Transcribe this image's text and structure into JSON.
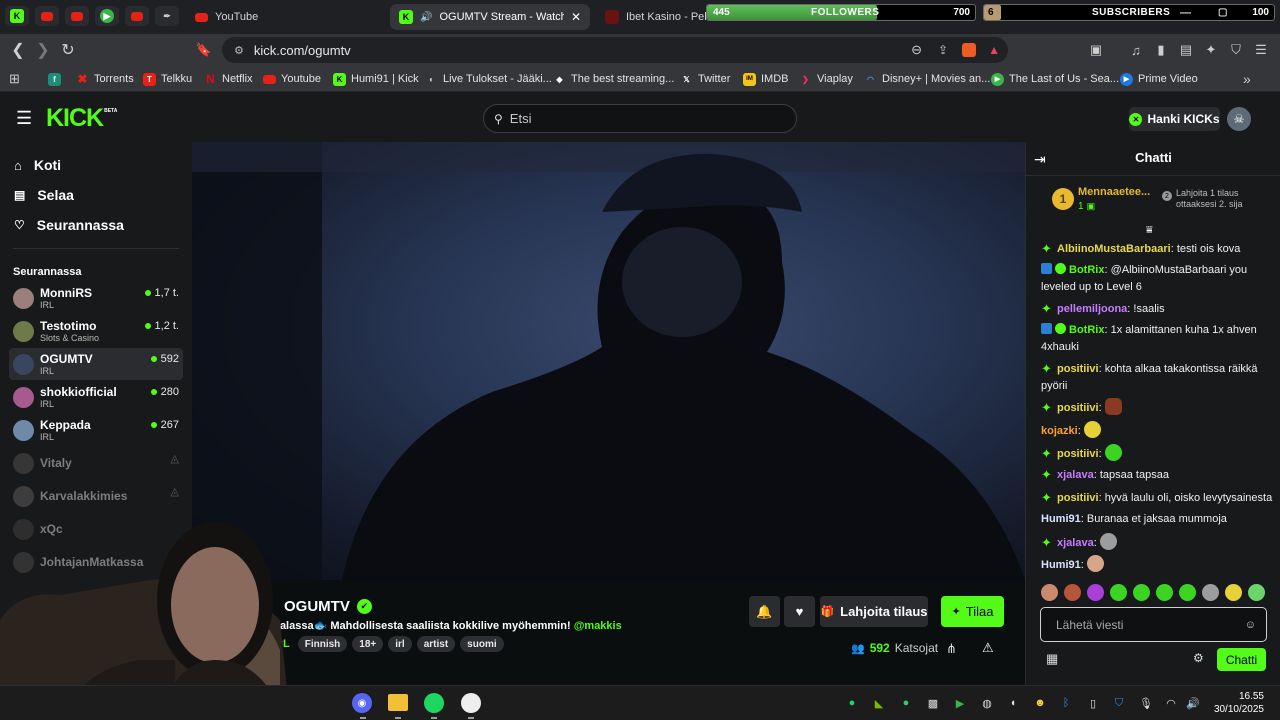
{
  "browser": {
    "tabs": [
      {
        "title": "YouTube",
        "favicon": "youtube-icon"
      },
      {
        "title": "OGUMTV Stream - Watch Live",
        "favicon": "kick-icon",
        "active": true,
        "audio": true
      },
      {
        "title": "Ibet Kasino - Pelaa",
        "favicon": "ibet-icon"
      }
    ],
    "url": "kick.com/ogumtv",
    "overlay": {
      "followers": {
        "current": "445",
        "label": "FOLLOWERS",
        "goal": "700",
        "progress": 0.636
      },
      "subscribers": {
        "current": "6",
        "label": "SUBSCRIBERS",
        "goal": "100",
        "progress": 0.06
      }
    },
    "bookmarks": [
      {
        "label": "Torrents",
        "icon": "torrent-icon"
      },
      {
        "label": "Telkku",
        "icon": "telkku-icon"
      },
      {
        "label": "Netflix",
        "icon": "netflix-icon"
      },
      {
        "label": "Youtube",
        "icon": "youtube-icon"
      },
      {
        "label": "Humi91 | Kick",
        "icon": "kick-icon"
      },
      {
        "label": "Live Tulokset - Jääki...",
        "icon": "live-icon"
      },
      {
        "label": "The best streaming...",
        "icon": "streaming-icon"
      },
      {
        "label": "Twitter",
        "icon": "x-icon"
      },
      {
        "label": "IMDB",
        "icon": "imdb-icon"
      },
      {
        "label": "Viaplay",
        "icon": "viaplay-icon"
      },
      {
        "label": "Disney+ | Movies an...",
        "icon": "disney-icon"
      },
      {
        "label": "The Last of Us - Sea...",
        "icon": "play-icon"
      },
      {
        "label": "Prime Video",
        "icon": "prime-icon"
      }
    ]
  },
  "kick": {
    "logo": "KICK",
    "logo_beta": "BETA",
    "search_placeholder": "Etsi",
    "kicks_button": "Hanki KICKs",
    "nav": [
      {
        "label": "Koti",
        "icon": "home-icon"
      },
      {
        "label": "Selaa",
        "icon": "browse-icon"
      },
      {
        "label": "Seurannassa",
        "icon": "heart-icon"
      }
    ],
    "following_heading": "Seurannassa",
    "channels": [
      {
        "name": "MonniRS",
        "category": "IRL",
        "viewers": "1,7 t.",
        "live": true,
        "color": "#9b7f7a"
      },
      {
        "name": "Testotimo",
        "category": "Slots & Casino",
        "viewers": "1,2 t.",
        "live": true,
        "color": "#6f7a4a"
      },
      {
        "name": "OGUMTV",
        "category": "IRL",
        "viewers": "592",
        "live": true,
        "active": true,
        "color": "#3a4660"
      },
      {
        "name": "shokkiofficial",
        "category": "IRL",
        "viewers": "280",
        "live": true,
        "color": "#a65a8f"
      },
      {
        "name": "Keppada",
        "category": "IRL",
        "viewers": "267",
        "live": true,
        "color": "#6f8aa8"
      },
      {
        "name": "Vitaly",
        "category": "",
        "viewers": "",
        "live": false,
        "color": "#5b5b5b"
      },
      {
        "name": "Karvalakkimies",
        "category": "",
        "viewers": "",
        "live": false,
        "color": "#6b6b6b"
      },
      {
        "name": "xQc",
        "category": "",
        "viewers": "",
        "live": false,
        "color": "#4a4a4a"
      },
      {
        "name": "JohtajanMatkassa",
        "category": "",
        "viewers": "",
        "live": false,
        "color": "#555555"
      }
    ],
    "stream": {
      "channel": "OGUMTV",
      "title_text": "Kalassa",
      "title_rest": "Mahdollisesta saaliista kokkilive myöhemmin!",
      "mention": "@makkis",
      "category": "IRL",
      "tags": [
        "Finnish",
        "18+",
        "irl",
        "artist",
        "suomi"
      ],
      "gift_button": "Lahjoita tilaus",
      "subscribe_button": "Tilaa",
      "viewers": "592",
      "viewers_label": "Katsojat"
    },
    "chat": {
      "title": "Chatti",
      "pinned_user": "Mennaaetee...",
      "pinned_rank": "1",
      "pinned_count": "1",
      "pinned_note": "Lahjoita 1 tilaus ottaaksesi 2. sija",
      "messages": [
        {
          "user": "AlbiinoMustaBarbaari",
          "color": "#e8d84b",
          "badge": "sparkle",
          "text": "testi ois kova"
        },
        {
          "user": "BotRix",
          "color": "#53fc18",
          "badge": "bot",
          "text": "@AlbiinoMustaBarbaari you leveled up to Level 6"
        },
        {
          "user": "pellemiljoona",
          "color": "#c77dff",
          "badge": "sparkle",
          "text": "!saalis"
        },
        {
          "user": "BotRix",
          "color": "#53fc18",
          "badge": "bot",
          "text": "1x alamittanen kuha 1x ahven 4xhauki"
        },
        {
          "user": "positiivi",
          "color": "#e8d84b",
          "badge": "sparkle",
          "text": "kohta alkaa takakontissa räikkä pyörii"
        },
        {
          "user": "positiivi",
          "color": "#e8d84b",
          "badge": "sparkle",
          "text": "",
          "emote": "#8a3a20"
        },
        {
          "user": "kojazki",
          "color": "#ff9f30",
          "badge": "",
          "text": "",
          "emote": "#e6d236"
        },
        {
          "user": "positiivi",
          "color": "#e8d84b",
          "badge": "sparkle",
          "text": "",
          "emote": "#3bd423"
        },
        {
          "user": "xjalava",
          "color": "#c77dff",
          "badge": "sparkle",
          "text": "tapsaa tapsaa"
        },
        {
          "user": "positiivi",
          "color": "#e8d84b",
          "badge": "sparkle",
          "text": "hyvä laulu oli, oisko levytysainesta"
        },
        {
          "user": "Humi91",
          "color": "#d7e3ff",
          "badge": "",
          "text": "Buranaa et jaksaa mummoja"
        },
        {
          "user": "xjalava",
          "color": "#c77dff",
          "badge": "sparkle",
          "text": "",
          "emote": "#9d9d9d"
        },
        {
          "user": "Humi91",
          "color": "#d7e3ff",
          "badge": "",
          "text": "",
          "emote": "#d9a58a"
        }
      ],
      "emote_bar": [
        "#c98a6e",
        "#b5553a",
        "#a83fd9",
        "#3bd423",
        "#3bd423",
        "#3bd423",
        "#3bd423",
        "#9d9d9d",
        "#e6d236",
        "#6bd46a"
      ],
      "input_placeholder": "Lähetä viesti",
      "send_button": "Chatti"
    }
  },
  "taskbar": {
    "time": "16.55",
    "date": "30/10/2025"
  },
  "colors": {
    "kick_green": "#53fc18",
    "dark_bg": "#0b0e0f",
    "panel_bg": "#18191b"
  }
}
